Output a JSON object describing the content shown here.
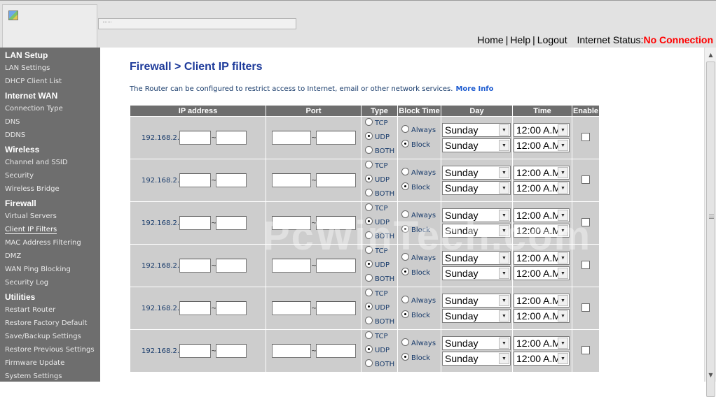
{
  "header": {
    "nav": {
      "home": "Home",
      "help": "Help",
      "logout": "Logout",
      "separator": "|"
    },
    "status_label": "Internet Status:",
    "status_value": "No Connection"
  },
  "sidebar": {
    "sections": [
      {
        "title": "LAN Setup",
        "items": [
          "LAN Settings",
          "DHCP Client List"
        ]
      },
      {
        "title": "Internet WAN",
        "items": [
          "Connection Type",
          "DNS",
          "DDNS"
        ]
      },
      {
        "title": "Wireless",
        "items": [
          "Channel and SSID",
          "Security",
          "Wireless Bridge"
        ]
      },
      {
        "title": "Firewall",
        "items": [
          "Virtual Servers",
          "Client IP Filters",
          "MAC Address Filtering",
          "DMZ",
          "WAN Ping Blocking",
          "Security Log"
        ]
      },
      {
        "title": "Utilities",
        "items": [
          "Restart Router",
          "Restore Factory Default",
          "Save/Backup Settings",
          "Restore Previous Settings",
          "Firmware Update",
          "System Settings"
        ]
      }
    ],
    "active_item": "Client IP Filters"
  },
  "main": {
    "title": "Firewall > Client IP filters",
    "intro": "The Router can be configured to restrict access to Internet, email or other network services.",
    "more_info": "More Info",
    "columns": [
      "IP address",
      "Port",
      "Type",
      "Block Time",
      "Day",
      "Time",
      "Enable"
    ],
    "ip_prefix": "192.168.2.",
    "range_separator": "~",
    "type_options": [
      "TCP",
      "UDP",
      "BOTH"
    ],
    "block_options": [
      "Always",
      "Block"
    ],
    "rows": [
      {
        "type": "UDP",
        "block": "Block",
        "day_from": "Sunday",
        "day_to": "Sunday",
        "time_from": "12:00 A.M",
        "time_to": "12:00 A.M",
        "enabled": false
      },
      {
        "type": "UDP",
        "block": "Block",
        "day_from": "Sunday",
        "day_to": "Sunday",
        "time_from": "12:00 A.M",
        "time_to": "12:00 A.M",
        "enabled": false
      },
      {
        "type": "UDP",
        "block": "Block",
        "day_from": "Sunday",
        "day_to": "Sunday",
        "time_from": "12:00 A.M",
        "time_to": "12:00 A.M",
        "enabled": false
      },
      {
        "type": "UDP",
        "block": "Block",
        "day_from": "Sunday",
        "day_to": "Sunday",
        "time_from": "12:00 A.M",
        "time_to": "12:00 A.M",
        "enabled": false
      },
      {
        "type": "UDP",
        "block": "Block",
        "day_from": "Sunday",
        "day_to": "Sunday",
        "time_from": "12:00 A.M",
        "time_to": "12:00 A.M",
        "enabled": false
      },
      {
        "type": "UDP",
        "block": "Block",
        "day_from": "Sunday",
        "day_to": "Sunday",
        "time_from": "12:00 A.M",
        "time_to": "12:00 A.M",
        "enabled": false
      }
    ]
  },
  "watermark": "PcWinTech.com",
  "colors": {
    "sidebar_bg": "#6e6e6e",
    "title": "#1d3a9a",
    "status_error": "#ff0000",
    "cell_bg": "#cdcdcd"
  }
}
